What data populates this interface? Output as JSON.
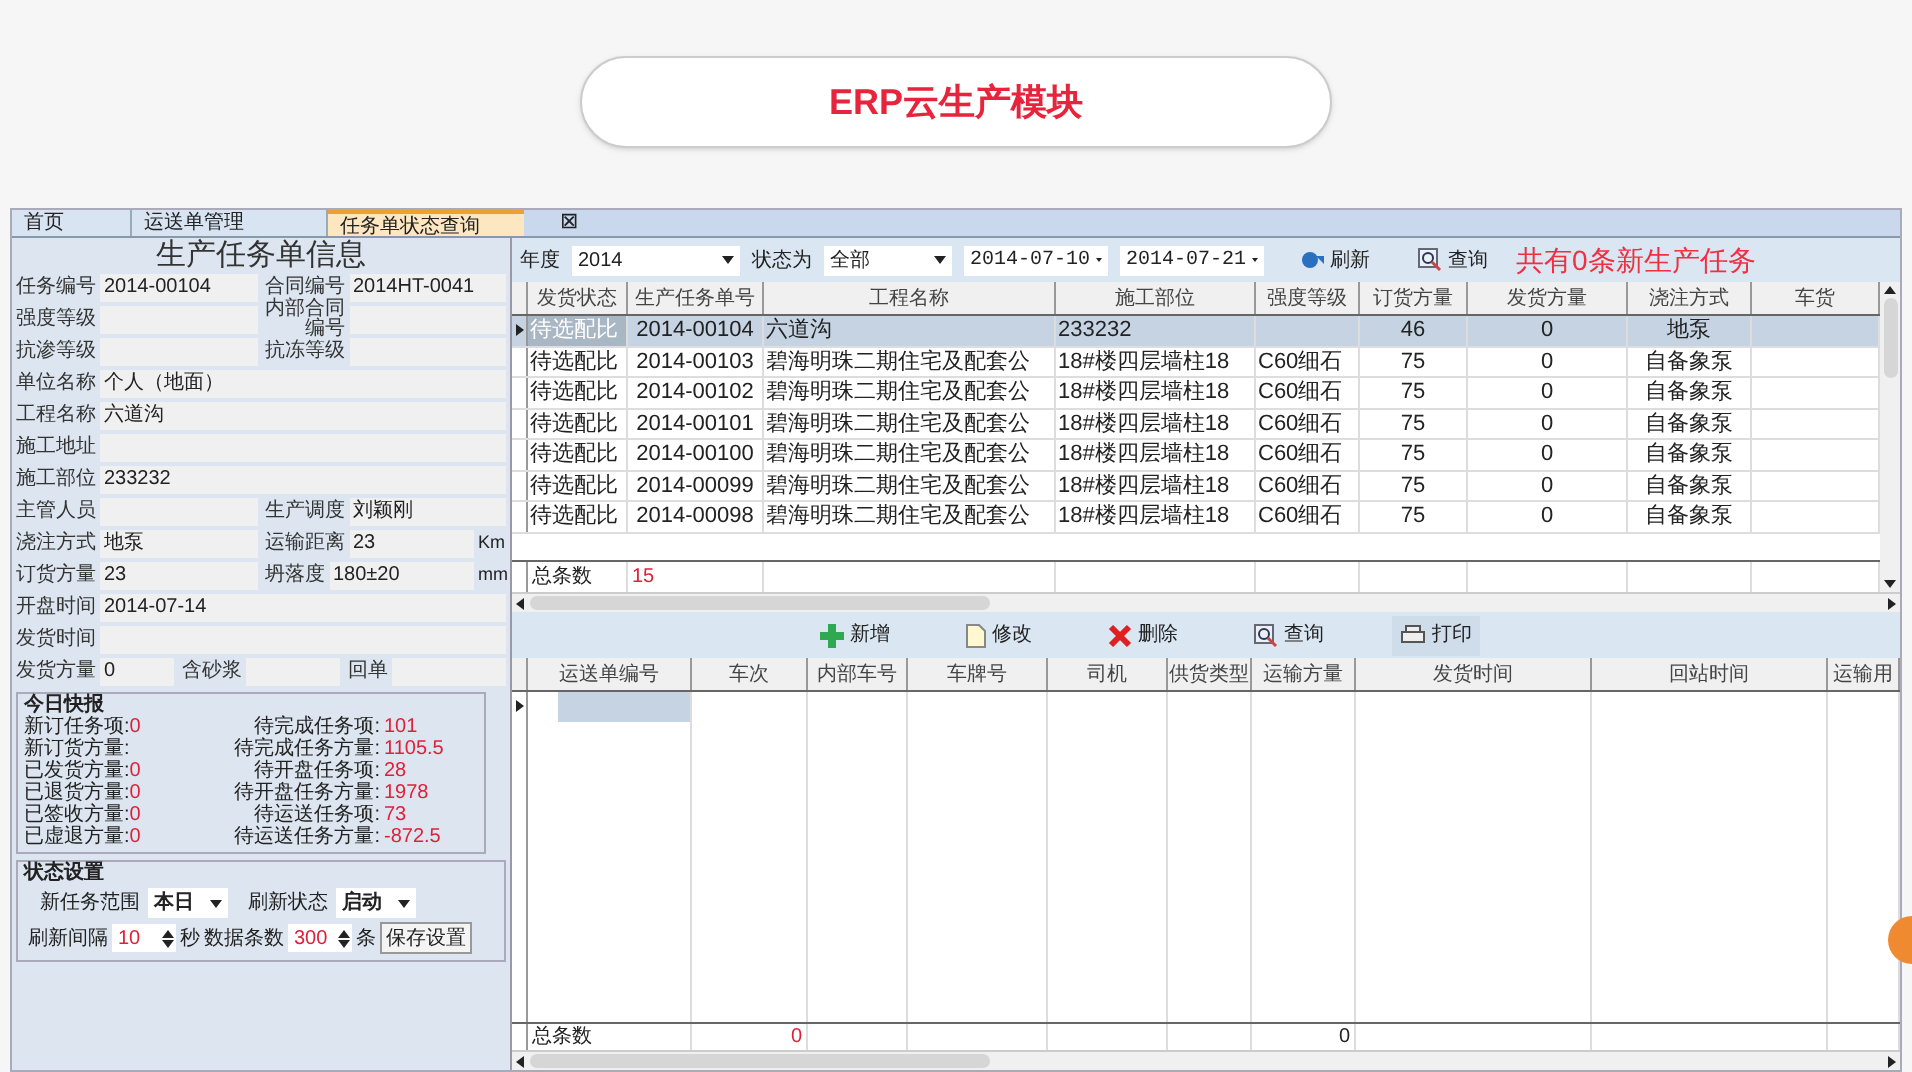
{
  "header": {
    "title": "ERP云生产模块"
  },
  "tabs": [
    {
      "label": "首页",
      "selected": false
    },
    {
      "label": "运送单管理",
      "selected": false
    },
    {
      "label": "任务单状态查询",
      "selected": true
    }
  ],
  "tab_close": "⊠",
  "form": {
    "title": "生产任务单信息",
    "rows": [
      [
        {
          "label": "任务编号",
          "value": "2014-00104"
        },
        {
          "label": "合同编号",
          "value": "2014HT-0041"
        }
      ],
      [
        {
          "label": "强度等级"
        },
        {
          "label": "内部合同编号"
        }
      ],
      [
        {
          "label": "抗渗等级"
        },
        {
          "label": "抗冻等级"
        }
      ],
      [
        {
          "label": "单位名称",
          "value": "个人（地面）"
        }
      ],
      [
        {
          "label": "工程名称",
          "value": "六道沟"
        }
      ],
      [
        {
          "label": "施工地址"
        }
      ],
      [
        {
          "label": "施工部位",
          "value": "233232"
        }
      ],
      [
        {
          "label": "主管人员"
        },
        {
          "label": "生产调度",
          "value": "刘颖刚"
        }
      ],
      [
        {
          "label": "浇注方式",
          "value": "地泵"
        },
        {
          "label": "运输距离",
          "value": "23",
          "unit": "Km"
        }
      ],
      [
        {
          "label": "订货方量",
          "value": "23"
        },
        {
          "label": "坍落度",
          "value": "180±20",
          "unit": "mm"
        }
      ],
      [
        {
          "label": "开盘时间",
          "value": "2014-07-14"
        }
      ],
      [
        {
          "label": "发货时间"
        }
      ],
      [
        {
          "label": "发货方量",
          "value": "0"
        },
        {
          "label": "含砂浆"
        },
        {
          "label": "回单"
        }
      ]
    ]
  },
  "report": {
    "title": "今日快报",
    "left": [
      {
        "label": "新订任务项:",
        "value": "0"
      },
      {
        "label": "新订货方量:"
      },
      {
        "label": "已发货方量:",
        "value": "0"
      },
      {
        "label": "已退货方量:",
        "value": "0"
      },
      {
        "label": "已签收方量:",
        "value": "0"
      },
      {
        "label": "已虚退方量:",
        "value": "0"
      }
    ],
    "right": [
      {
        "label": "待完成任务项:",
        "value": "101"
      },
      {
        "label": "待完成任务方量:",
        "value": "1105.5"
      },
      {
        "label": "待开盘任务项:",
        "value": "28"
      },
      {
        "label": "待开盘任务方量:",
        "value": "1978"
      },
      {
        "label": "待运送任务项:",
        "value": "73"
      },
      {
        "label": "待运送任务方量:",
        "value": "-872.5"
      }
    ]
  },
  "settings": {
    "title": "状态设置",
    "range": {
      "label": "新任务范围",
      "value": "本日"
    },
    "refresh_state": {
      "label": "刷新状态",
      "value": "启动"
    },
    "interval": {
      "label": "刷新间隔",
      "value": "10",
      "unit": "秒"
    },
    "count": {
      "label": "数据条数",
      "value": "300",
      "unit": "条"
    },
    "save": "保存设置"
  },
  "toolbar": {
    "year": {
      "label": "年度",
      "value": "2014"
    },
    "status": {
      "label": "状态为",
      "value": "全部"
    },
    "date_from": "2014-07-10",
    "date_to": "2014-07-21",
    "refresh": "刷新",
    "query": "查询",
    "notice": "共有0条新生产任务"
  },
  "task_table": {
    "columns": [
      "发货状态",
      "生产任务单号",
      "工程名称",
      "施工部位",
      "强度等级",
      "订货方量",
      "发货方量",
      "浇注方式",
      "车货"
    ],
    "rows": [
      {
        "selected": true,
        "status": "待选配比",
        "task_no": "2014-00104",
        "project": "六道沟",
        "site": "233232",
        "order_qty": "46",
        "ship_qty": "0",
        "pour": "地泵"
      },
      {
        "selected": false,
        "status": "待选配比",
        "task_no": "2014-00103",
        "project": "碧海明珠二期住宅及配套公",
        "site": "18#楼四层墙柱18",
        "grade": "C60细石",
        "order_qty": "75",
        "ship_qty": "0",
        "pour": "自备象泵"
      },
      {
        "selected": false,
        "status": "待选配比",
        "task_no": "2014-00102",
        "project": "碧海明珠二期住宅及配套公",
        "site": "18#楼四层墙柱18",
        "grade": "C60细石",
        "order_qty": "75",
        "ship_qty": "0",
        "pour": "自备象泵"
      },
      {
        "selected": false,
        "status": "待选配比",
        "task_no": "2014-00101",
        "project": "碧海明珠二期住宅及配套公",
        "site": "18#楼四层墙柱18",
        "grade": "C60细石",
        "order_qty": "75",
        "ship_qty": "0",
        "pour": "自备象泵"
      },
      {
        "selected": false,
        "status": "待选配比",
        "task_no": "2014-00100",
        "project": "碧海明珠二期住宅及配套公",
        "site": "18#楼四层墙柱18",
        "grade": "C60细石",
        "order_qty": "75",
        "ship_qty": "0",
        "pour": "自备象泵"
      },
      {
        "selected": false,
        "status": "待选配比",
        "task_no": "2014-00099",
        "project": "碧海明珠二期住宅及配套公",
        "site": "18#楼四层墙柱18",
        "grade": "C60细石",
        "order_qty": "75",
        "ship_qty": "0",
        "pour": "自备象泵"
      },
      {
        "selected": false,
        "status": "待选配比",
        "task_no": "2014-00098",
        "project": "碧海明珠二期住宅及配套公",
        "site": "18#楼四层墙柱18",
        "grade": "C60细石",
        "order_qty": "75",
        "ship_qty": "0",
        "pour": "自备象泵"
      }
    ],
    "summary": {
      "label": "总条数",
      "count": "15"
    }
  },
  "actions": [
    {
      "kind": "add",
      "label": "新增"
    },
    {
      "kind": "edit",
      "label": "修改"
    },
    {
      "kind": "delete",
      "label": "删除"
    },
    {
      "kind": "query",
      "label": "查询"
    },
    {
      "kind": "print",
      "label": "打印"
    }
  ],
  "delivery_table": {
    "columns": [
      "运送单编号",
      "车次",
      "内部车号",
      "车牌号",
      "司机",
      "供货类型",
      "运输方量",
      "发货时间",
      "回站时间",
      "运输用"
    ],
    "summary": {
      "label": "总条数",
      "trips": "0",
      "volume": "0"
    }
  }
}
